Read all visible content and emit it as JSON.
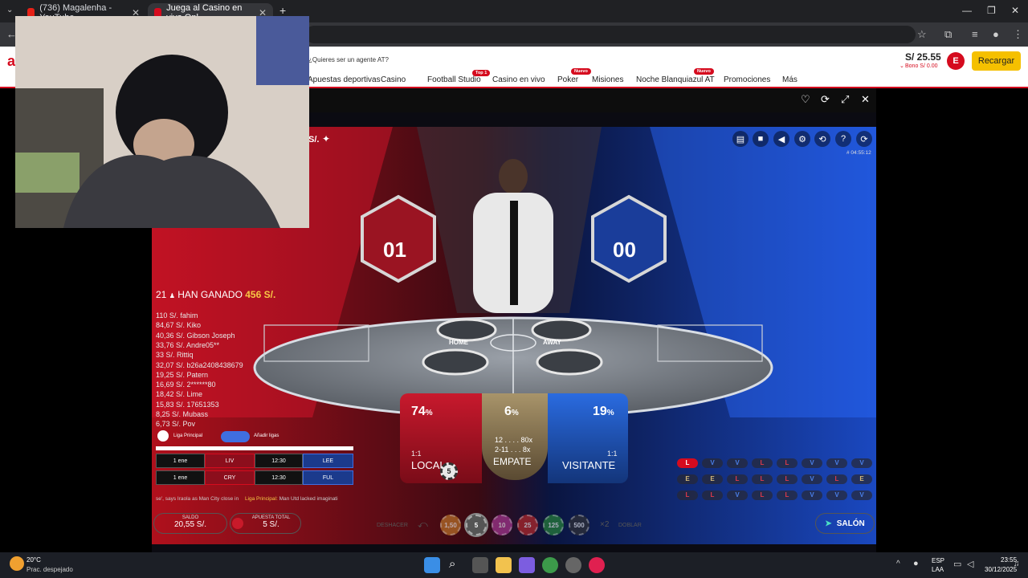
{
  "browser": {
    "tabs": [
      {
        "label": "(736) Magalenha - YouTube"
      },
      {
        "label": "Juega al Casino en vivo Onl"
      }
    ],
    "new_tab": "+"
  },
  "site": {
    "logo": "a",
    "agent_prompt": "¿Quieres ser un agente AT?",
    "nav": [
      {
        "label": "Apuestas deportivas"
      },
      {
        "label": "Casino"
      },
      {
        "label": "Football Studio",
        "badge": "Top 1"
      },
      {
        "label": "Casino en vivo"
      },
      {
        "label": "Poker",
        "badge": "Nuevo"
      },
      {
        "label": "Misiones"
      },
      {
        "label": "Noche Blanquiazul AT",
        "badge": "Nuevo"
      },
      {
        "label": "Promociones"
      },
      {
        "label": "Más"
      }
    ],
    "balance": "S/ 25.55",
    "bonus": "Bono S/  0.00",
    "avatar_letter": "E",
    "recharge_label": "Recargar"
  },
  "game": {
    "title_suffix": "S/.",
    "timestamp": "# 04:55:12",
    "winners": {
      "count": "21",
      "label": "HAN GANADO",
      "amount": "456 S/.",
      "rows": [
        "110 S/. fahim",
        "84,67 S/. Kiko",
        "40,36 S/. Gibson Joseph",
        "33,76 S/. Andre05**",
        "33 S/. Rittiq",
        "32,07 S/. b26a2408438679",
        "19,25 S/. Patern",
        "16,69 S/. 2******80",
        "18,42 S/. Lime",
        "15,83 S/. 17651353",
        "8,25 S/. Mubass",
        "6,73 S/. Pov"
      ]
    },
    "scores": {
      "home": "01",
      "away": "00"
    },
    "table_labels": {
      "home": "HOME",
      "away": "AWAY"
    },
    "bets": {
      "local": {
        "pct": "74",
        "odds": "1:1",
        "label": "LOCAL",
        "chip": "5"
      },
      "draw": {
        "pct": "6",
        "odds1": "12 . . . . 80x",
        "odds2": "2-11 . . . 8x",
        "label": "EMPATE"
      },
      "visitor": {
        "pct": "19",
        "odds": "1:1",
        "label": "VISITANTE"
      }
    },
    "pct_sign": "%",
    "history": [
      [
        "L",
        "V",
        "V",
        "L",
        "L",
        "V",
        "V",
        "V"
      ],
      [
        "E",
        "E",
        "L",
        "L",
        "L",
        "V",
        "L",
        "E"
      ],
      [
        "L",
        "L",
        "V",
        "L",
        "L",
        "V",
        "V",
        "V"
      ]
    ],
    "league": {
      "name": "Liga Principal",
      "add": "Añadir ligas",
      "matches": [
        {
          "date": "1 ene",
          "home": "LIV",
          "time": "12:30",
          "away": "LEE"
        },
        {
          "date": "1 ene",
          "home": "CRY",
          "time": "12:30",
          "away": "FUL"
        }
      ],
      "ticker_a": "se', says Iraola as Man City close in",
      "ticker_b": "Liga Principal:",
      "ticker_c": "Man Utd lacked imaginati"
    },
    "balance_label": "SALDO",
    "balance_value": "20,55 S/.",
    "total_bet_label": "APUESTA TOTAL",
    "total_bet_value": "5 S/.",
    "undo_label": "DESHACER",
    "double_label": "DOBLAR",
    "double_x": "×2",
    "chips": [
      "1,50",
      "5",
      "10",
      "25",
      "125",
      "500"
    ],
    "lobby_label": "SALÓN"
  },
  "taskbar": {
    "temp": "20°C",
    "weather": "Prac. despejado",
    "lang1": "ESP",
    "lang2": "LAA",
    "time": "23:55",
    "date": "30/12/2025"
  },
  "colors": {
    "brand_red": "#d50b1e",
    "recharge_yellow": "#f5c000",
    "local_red": "#c0162a",
    "visitor_blue": "#1f5fd6",
    "draw_gold": "#8a7a5a"
  }
}
